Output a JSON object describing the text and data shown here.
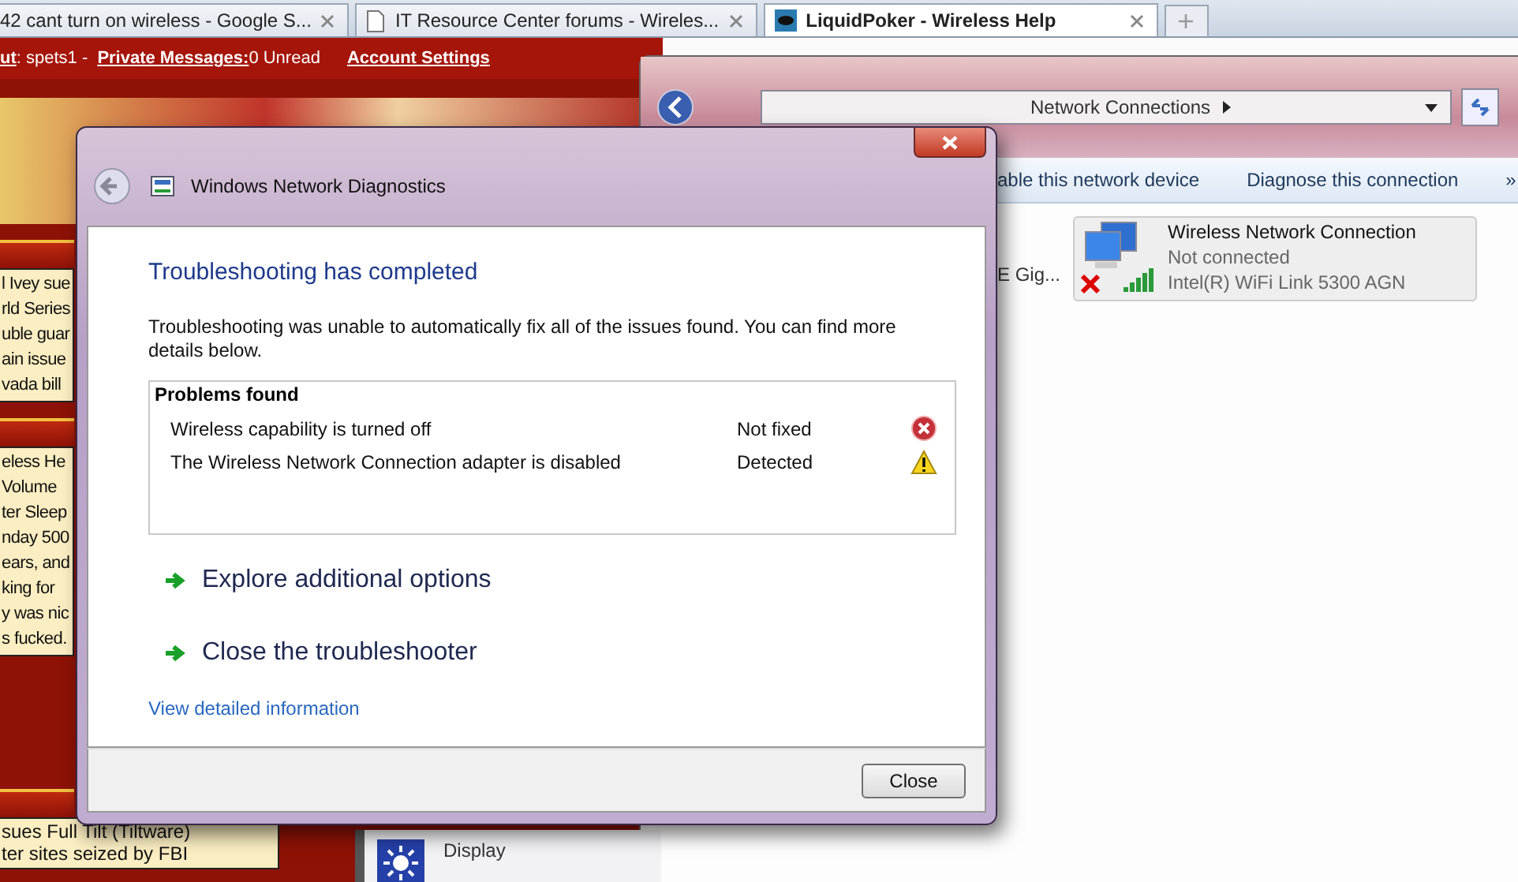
{
  "browser_tabs": [
    {
      "label": "42 cant turn on wireless - Google S...",
      "selected": false
    },
    {
      "label": "IT Resource Center forums - Wireles...",
      "selected": false
    },
    {
      "label": "LiquidPoker - Wireless Help",
      "selected": true
    }
  ],
  "forum": {
    "user_bar": {
      "prefix": "ut",
      "user": ": spets1 - ",
      "messages_link": "Private Messages:",
      "unread": "0 Unread",
      "settings_link": "Account Settings"
    },
    "news_boxes": [
      {
        "lines": [
          "l Ivey sue",
          "rld Series",
          "uble guar",
          "ain issue",
          "vada bill"
        ]
      },
      {
        "lines": [
          "eless He",
          "Volume",
          "ter Sleep",
          "nday 500",
          "ears, and",
          "king for",
          "y was nic",
          "s fucked."
        ]
      },
      {
        "lines": [
          "sues Full Tilt (Tiltware)",
          "ter sites seized by FBI"
        ]
      }
    ]
  },
  "explorer": {
    "address": [
      "Network Connections"
    ],
    "commands": [
      "able this network device",
      "Diagnose this connection",
      "»"
    ],
    "partial_item": "E Gig...",
    "adapters": [
      {
        "name": "Wireless Network Connection",
        "status": "Not connected",
        "device": "Intel(R)  WiFi Link 5300 AGN"
      }
    ]
  },
  "control_panel_item": {
    "label": "Display"
  },
  "dialog": {
    "title": "Windows Network Diagnostics",
    "heading": "Troubleshooting has completed",
    "message": "Troubleshooting was unable to automatically fix all of the issues found. You can find more details below.",
    "problems": {
      "title": "Problems found",
      "rows": [
        {
          "problem": "Wireless capability is turned off",
          "status": "Not fixed",
          "kind": "error"
        },
        {
          "problem": "The Wireless Network Connection adapter is disabled",
          "status": "Detected",
          "kind": "warning"
        }
      ]
    },
    "options": [
      "Explore additional options",
      "Close the troubleshooter"
    ],
    "details_link": "View detailed information",
    "buttons": [
      "Close"
    ]
  }
}
